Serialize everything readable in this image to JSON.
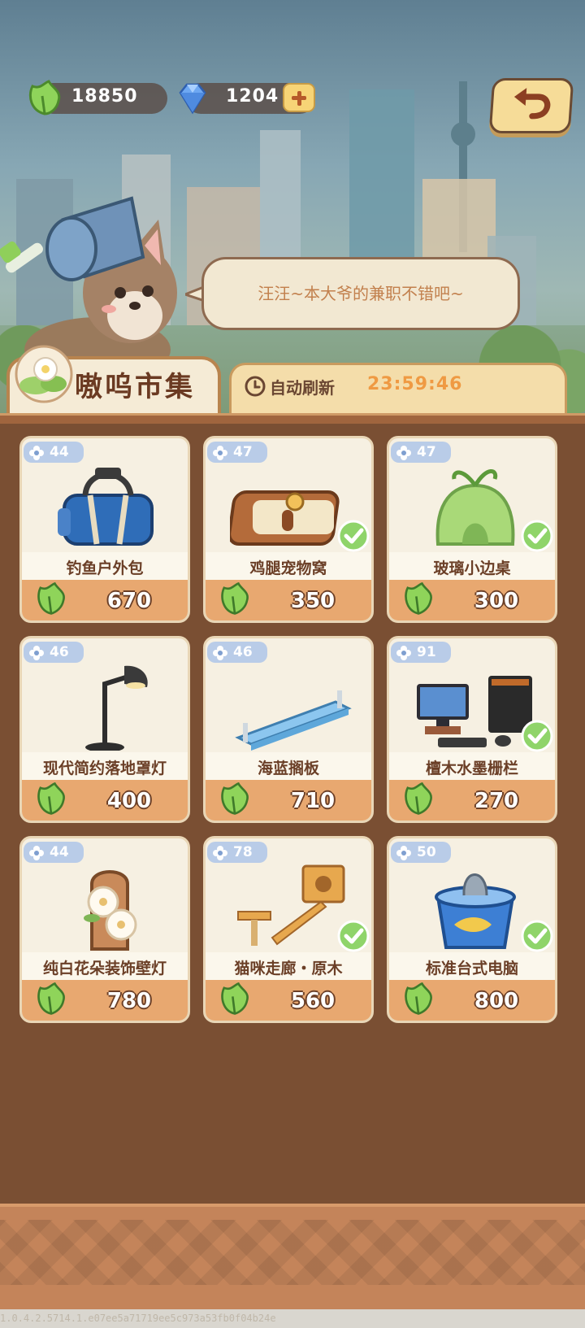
{
  "currency": {
    "leaf_amount": "18850",
    "gem_amount": "1204"
  },
  "bubble": {
    "text": "汪汪~本大爷的兼职不错吧~"
  },
  "market": {
    "title": "嗷呜市集",
    "refresh_label": "自动刷新",
    "refresh_time": "23:59:46"
  },
  "items": [
    {
      "level": "44",
      "name": "钓鱼户外包",
      "price": "670",
      "owned": false,
      "icon": "fishing-bag-icon"
    },
    {
      "level": "47",
      "name": "鸡腿宠物窝",
      "price": "350",
      "owned": true,
      "icon": "pet-bed-icon"
    },
    {
      "level": "47",
      "name": "玻璃小边桌",
      "price": "300",
      "owned": true,
      "icon": "leaf-tent-icon"
    },
    {
      "level": "46",
      "name": "现代简约落地罩灯",
      "price": "400",
      "owned": false,
      "icon": "floor-lamp-icon"
    },
    {
      "level": "46",
      "name": "海蓝搁板",
      "price": "710",
      "owned": false,
      "icon": "blue-shelf-icon"
    },
    {
      "level": "91",
      "name": "檀木水墨栅栏",
      "price": "270",
      "owned": true,
      "icon": "computer-desk-icon"
    },
    {
      "level": "44",
      "name": "纯白花朵装饰壁灯",
      "price": "780",
      "owned": false,
      "icon": "flower-wall-lamp-icon"
    },
    {
      "level": "78",
      "name": "猫咪走廊・原木",
      "price": "560",
      "owned": true,
      "icon": "cat-walkway-icon"
    },
    {
      "level": "50",
      "name": "标准台式电脑",
      "price": "800",
      "owned": true,
      "icon": "fish-bucket-icon"
    }
  ],
  "footer": {
    "version": "1.0.4.2.5714.1.e07ee5a71719ee5c973a53fb0f04b24e"
  },
  "colors": {
    "accent": "#ef9a43",
    "panel": "#7a4f33",
    "price_strip": "#e8a870",
    "badge": "#b9cce8"
  }
}
